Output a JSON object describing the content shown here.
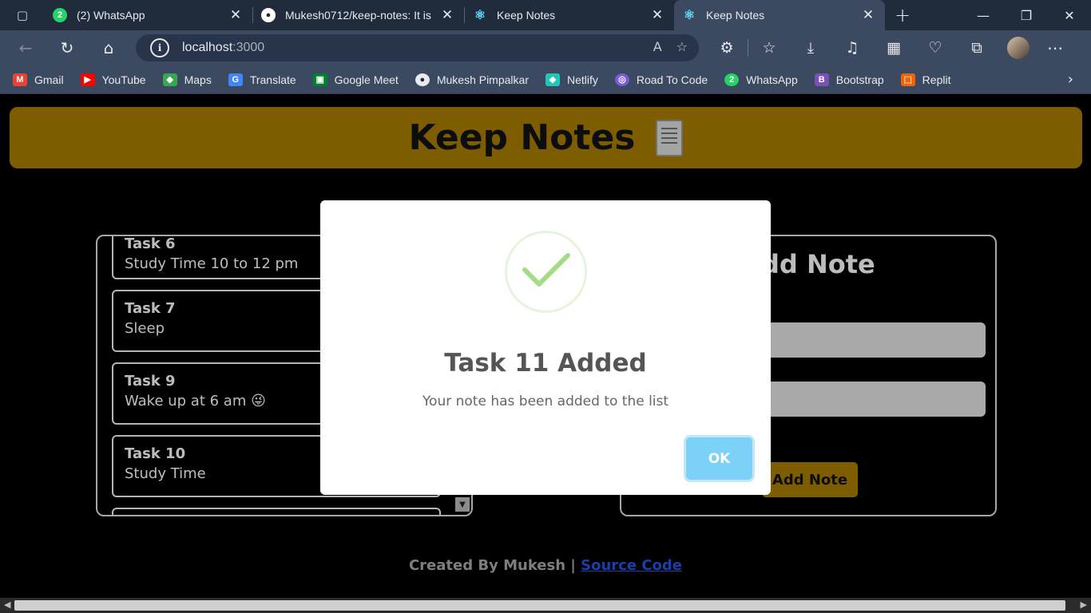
{
  "browser": {
    "tabs": [
      {
        "title": "(2) WhatsApp",
        "icon": "whatsapp-icon",
        "badge": "2",
        "active": false
      },
      {
        "title": "Mukesh0712/keep-notes: It is",
        "icon": "github-icon",
        "active": false
      },
      {
        "title": "Keep Notes",
        "icon": "react-icon",
        "active": false
      },
      {
        "title": "Keep Notes",
        "icon": "react-icon",
        "active": true
      }
    ],
    "url_host": "localhost",
    "url_port": ":3000",
    "bookmarks": [
      {
        "label": "Gmail",
        "icon": "gmail-icon",
        "color": "#ea4335",
        "glyph": "M"
      },
      {
        "label": "YouTube",
        "icon": "youtube-icon",
        "color": "#ff0000",
        "glyph": "▶"
      },
      {
        "label": "Maps",
        "icon": "maps-icon",
        "color": "#34a853",
        "glyph": "◆"
      },
      {
        "label": "Translate",
        "icon": "translate-icon",
        "color": "#4285f4",
        "glyph": "G"
      },
      {
        "label": "Google Meet",
        "icon": "meet-icon",
        "color": "#00832d",
        "glyph": "▣"
      },
      {
        "label": "Mukesh Pimpalkar",
        "icon": "github-icon",
        "color": "#24292f",
        "glyph": "●"
      },
      {
        "label": "Netlify",
        "icon": "netlify-icon",
        "color": "#20c6b7",
        "glyph": "◆"
      },
      {
        "label": "Road To Code",
        "icon": "roadtocode-icon",
        "color": "#7b5cd6",
        "glyph": "◎"
      },
      {
        "label": "WhatsApp",
        "icon": "whatsapp-icon",
        "color": "#25d366",
        "glyph": "2"
      },
      {
        "label": "Bootstrap",
        "icon": "bootstrap-icon",
        "color": "#7952b3",
        "glyph": "B"
      },
      {
        "label": "Replit",
        "icon": "replit-icon",
        "color": "#f26207",
        "glyph": "⬚"
      }
    ]
  },
  "app": {
    "title": "Keep Notes",
    "notes": [
      {
        "title": "Task 6",
        "desc": "Study Time 10 to 12 pm"
      },
      {
        "title": "Task 7",
        "desc": "Sleep"
      },
      {
        "title": "Task 9",
        "desc": "Wake up at 6 am 😜"
      },
      {
        "title": "Task 10",
        "desc": "Study Time"
      }
    ],
    "form": {
      "heading": "Add Note",
      "button": "Add Note"
    },
    "footer": {
      "text": "Created By Mukesh |",
      "link": "Source Code"
    }
  },
  "modal": {
    "title": "Task 11 Added",
    "text": "Your note has been added to the list",
    "ok": "OK"
  }
}
